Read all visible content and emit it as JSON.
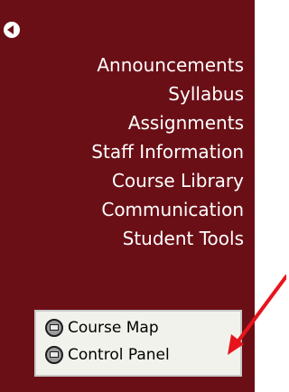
{
  "nav": {
    "items": [
      {
        "label": "Announcements"
      },
      {
        "label": "Syllabus"
      },
      {
        "label": "Assignments"
      },
      {
        "label": "Staff Information"
      },
      {
        "label": "Course Library"
      },
      {
        "label": "Communication"
      },
      {
        "label": "Student Tools"
      }
    ]
  },
  "tools": {
    "course_map": {
      "label": "Course Map",
      "icon": "course-map-icon"
    },
    "control_panel": {
      "label": "Control Panel",
      "icon": "control-panel-icon"
    }
  },
  "colors": {
    "panel_bg": "#6b0f16",
    "nav_text": "#ffffff",
    "tools_bg": "#f2f2ec",
    "annotation_arrow": "#e8141c"
  }
}
